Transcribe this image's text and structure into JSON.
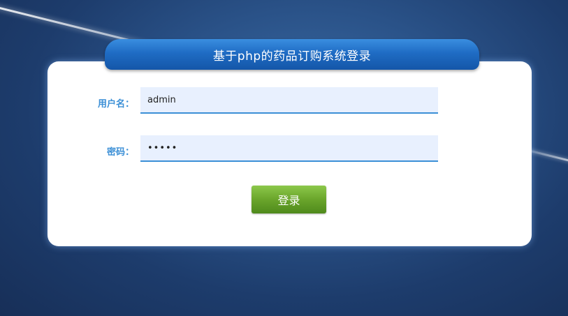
{
  "page": {
    "title": "基于php的药品订购系统登录"
  },
  "form": {
    "username_label": "用户名：",
    "username_value": "admin",
    "password_label": "密码：",
    "password_value": "12345",
    "submit_label": "登录"
  },
  "colors": {
    "label": "#3b8fd6",
    "title_bar": "#1f6cc4",
    "button": "#6aa52b",
    "field_bg": "#e8f0fe"
  }
}
